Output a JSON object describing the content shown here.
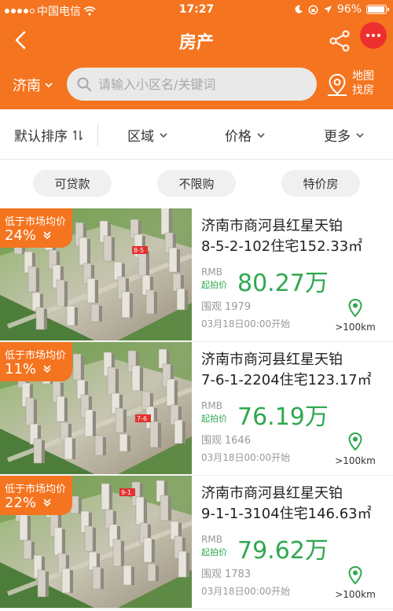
{
  "colors": {
    "accent": "#f5741f",
    "price_green": "#2fa84f",
    "more_red": "#ee2f2f"
  },
  "status_bar": {
    "carrier": "中国电信",
    "time": "17:27",
    "battery": "96%",
    "battery_level": 0.96,
    "icons": [
      "signal-icon",
      "wifi-icon",
      "moon-icon",
      "location-arrow-icon",
      "lock-rotation-icon",
      "battery-icon"
    ]
  },
  "nav": {
    "title": "房产",
    "back_icon": "chevron-left-icon",
    "share_icon": "share-icon",
    "more_icon": "more-dots-icon"
  },
  "search": {
    "city": "济南",
    "placeholder": "请输入小区名/关键词",
    "map_label_1": "地图",
    "map_label_2": "找房"
  },
  "filters": [
    {
      "label": "默认排序",
      "icon": "sort-icon"
    },
    {
      "label": "区域",
      "icon": "chevron-down-icon"
    },
    {
      "label": "价格",
      "icon": "chevron-down-icon"
    },
    {
      "label": "更多",
      "icon": "chevron-down-icon"
    }
  ],
  "tags": [
    "可贷款",
    "不限购",
    "特价房"
  ],
  "listings": [
    {
      "discount_label": "低于市场均价",
      "discount": "24%",
      "badge": "8-5",
      "title_line1": "济南市商河县红星天铂",
      "title_line2": "8-5-2-102住宅152.33㎡",
      "currency": "RMB",
      "price_label": "起拍价",
      "price": "80.27万",
      "views_label": "围观",
      "views": "1979",
      "start": "03月18日00:00开始",
      "distance": ">100km"
    },
    {
      "discount_label": "低于市场均价",
      "discount": "11%",
      "badge": "7-6",
      "title_line1": "济南市商河县红星天铂",
      "title_line2": "7-6-1-2204住宅123.17㎡",
      "currency": "RMB",
      "price_label": "起拍价",
      "price": "76.19万",
      "views_label": "围观",
      "views": "1646",
      "start": "03月18日00:00开始",
      "distance": ">100km"
    },
    {
      "discount_label": "低于市场均价",
      "discount": "22%",
      "badge": "9-1",
      "title_line1": "济南市商河县红星天铂",
      "title_line2": "9-1-1-3104住宅146.63㎡",
      "currency": "RMB",
      "price_label": "起拍价",
      "price": "79.62万",
      "views_label": "围观",
      "views": "1783",
      "start": "03月18日00:00开始",
      "distance": ">100km"
    }
  ]
}
